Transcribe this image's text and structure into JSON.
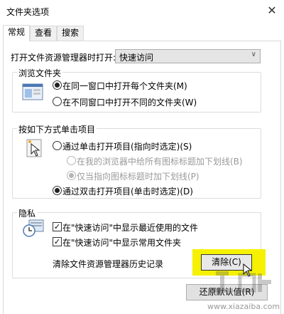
{
  "window": {
    "title": "文件夹选项",
    "close_glyph": "✕"
  },
  "tabs": [
    {
      "label": "常规",
      "active": true
    },
    {
      "label": "查看",
      "active": false
    },
    {
      "label": "搜索",
      "active": false
    }
  ],
  "open_explorer": {
    "label": "打开文件资源管理器时打开:",
    "selected": "快速访问"
  },
  "browse_folders": {
    "title": "浏览文件夹",
    "icon": "folder-window-icon",
    "options": [
      {
        "label": "在同一窗口中打开每个文件夹(M)",
        "selected": true
      },
      {
        "label": "在不同窗口中打开不同的文件夹(W)",
        "selected": false
      }
    ]
  },
  "click_items": {
    "title": "按如下方式单击项目",
    "icon": "pointer-click-icon",
    "single_click": {
      "label": "通过单击打开项目(指向时选定)(S)",
      "selected": false
    },
    "underline_options": [
      {
        "label": "在我的浏览器中给所有图标标题加下划线(B)",
        "selected": false,
        "disabled": true
      },
      {
        "label": "仅当指向图标标题时加下划线(P)",
        "selected": true,
        "disabled": true
      }
    ],
    "double_click": {
      "label": "通过双击打开项目(单击时选定)(D)",
      "selected": true
    }
  },
  "privacy": {
    "title": "隐私",
    "icon": "privacy-clock-icon",
    "checks": [
      {
        "label": "在\"快速访问\"中显示最近使用的文件",
        "checked": true
      },
      {
        "label": "在\"快速访问\"中显示常用文件夹",
        "checked": true
      }
    ],
    "clear_history_label": "清除文件资源管理器历史记录",
    "clear_button": "清除(C)"
  },
  "restore_defaults_button": "还原默认值(R)",
  "watermark": "www.xiazaiba.com",
  "colors": {
    "highlight": "#f5f100",
    "button_bg": "#e1e1e1",
    "select_bg": "#e5e5e5"
  }
}
